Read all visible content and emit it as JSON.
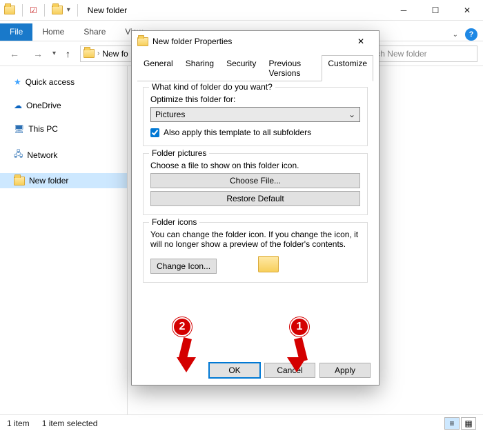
{
  "window": {
    "title": "New folder",
    "ribbon_tabs": {
      "file": "File",
      "home": "Home",
      "share": "Share",
      "view": "View"
    },
    "address": "New fo",
    "search_placeholder": "Search New folder"
  },
  "sidebar": {
    "items": [
      {
        "label": "Quick access",
        "icon": "star-icon"
      },
      {
        "label": "OneDrive",
        "icon": "cloud-icon"
      },
      {
        "label": "This PC",
        "icon": "pc-icon"
      },
      {
        "label": "Network",
        "icon": "network-icon"
      },
      {
        "label": "New folder",
        "icon": "folder-icon"
      }
    ]
  },
  "statusbar": {
    "count": "1 item",
    "selection": "1 item selected"
  },
  "dialog": {
    "title": "New folder Properties",
    "tabs": [
      "General",
      "Sharing",
      "Security",
      "Previous Versions",
      "Customize"
    ],
    "active_tab": "Customize",
    "customize": {
      "question": "What kind of folder do you want?",
      "optimize_label": "Optimize this folder for:",
      "optimize_value": "Pictures",
      "apply_sub_checked": true,
      "apply_sub_label": "Also apply this template to all subfolders",
      "folder_pictures_legend": "Folder pictures",
      "folder_pictures_desc": "Choose a file to show on this folder icon.",
      "choose_file": "Choose File...",
      "restore_default": "Restore Default",
      "folder_icons_legend": "Folder icons",
      "folder_icons_desc": "You can change the folder icon. If you change the icon, it will no longer show a preview of the folder's contents.",
      "change_icon": "Change Icon..."
    },
    "buttons": {
      "ok": "OK",
      "cancel": "Cancel",
      "apply": "Apply"
    }
  },
  "annotations": {
    "one": "1",
    "two": "2"
  }
}
